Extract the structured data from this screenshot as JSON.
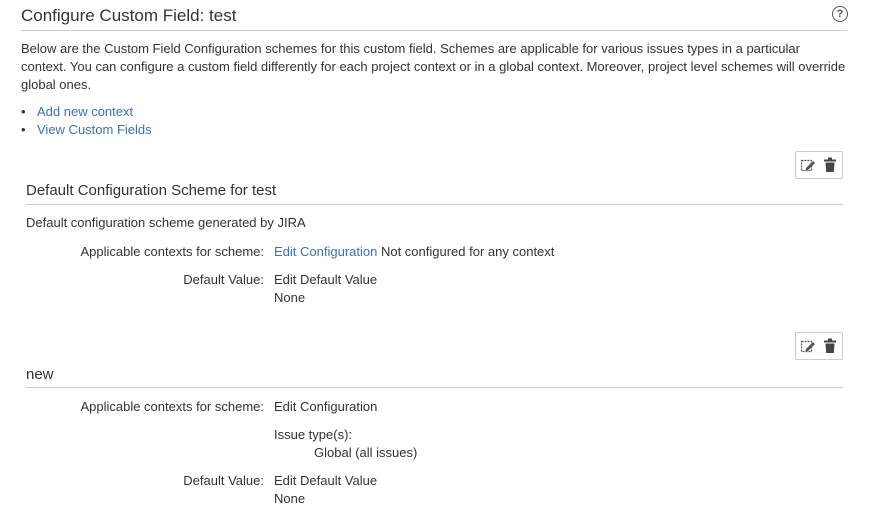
{
  "header": {
    "title": "Configure Custom Field: test",
    "help_icon": "question-circle-icon"
  },
  "intro": {
    "text": "Below are the Custom Field Configuration schemes for this custom field. Schemes are applicable for various issues types in a particular context. You can configure a custom field differently for each project context or in a global context. Moreover, project level schemes will override global ones."
  },
  "links": {
    "add_context": "Add new context",
    "view_custom_fields": "View Custom Fields"
  },
  "schemes": [
    {
      "title": "Default Configuration Scheme for test",
      "description": "Default configuration scheme generated by JIRA",
      "contexts_label": "Applicable contexts for scheme:",
      "edit_config_link": "Edit Configuration",
      "contexts_note": "Not configured for any context",
      "default_value_label": "Default Value:",
      "edit_default_link": "Edit Default Value",
      "default_value": "None",
      "tools": {
        "edit_icon": "edit-scheme-icon",
        "delete_icon": "trash-icon"
      }
    },
    {
      "title": "new",
      "contexts_label": "Applicable contexts for scheme:",
      "edit_config_link": "Edit Configuration",
      "issue_types_label": "Issue type(s):",
      "issue_types_value": "Global (all issues)",
      "default_value_label": "Default Value:",
      "edit_default_link": "Edit Default Value",
      "default_value": "None",
      "tools": {
        "edit_icon": "edit-scheme-icon",
        "delete_icon": "trash-icon"
      }
    }
  ],
  "colors": {
    "link": "#3b73af",
    "text": "#333333",
    "rule": "#cccccc"
  }
}
